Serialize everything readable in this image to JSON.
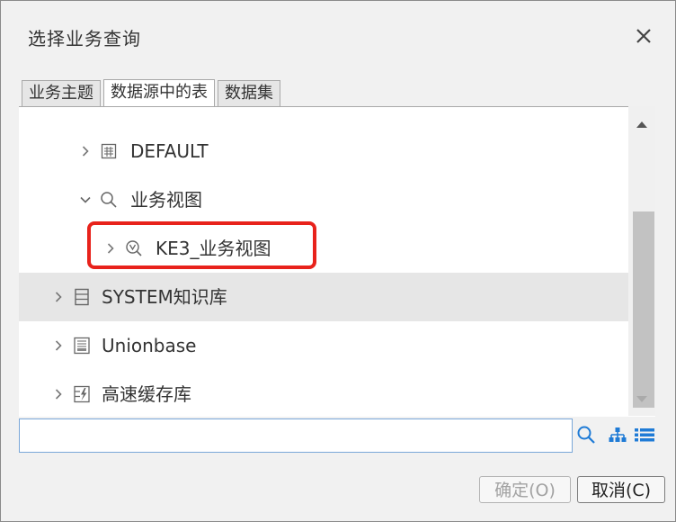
{
  "dialog": {
    "title": "选择业务查询",
    "close_label": "×"
  },
  "tabs": [
    {
      "label": "业务主题",
      "active": false
    },
    {
      "label": "数据源中的表",
      "active": true
    },
    {
      "label": "数据集",
      "active": false
    }
  ],
  "tree": {
    "items": [
      {
        "label": "DEFAULT",
        "icon": "schema-icon",
        "expanded": false,
        "selected": false
      },
      {
        "label": "业务视图",
        "icon": "search-view-icon",
        "expanded": true,
        "selected": false
      },
      {
        "label": "KE3_业务视图",
        "icon": "business-view-icon",
        "expanded": false,
        "selected": false,
        "highlighted": true
      },
      {
        "label": "SYSTEM知识库",
        "icon": "database-icon",
        "expanded": false,
        "selected": true
      },
      {
        "label": "Unionbase",
        "icon": "database-server-icon",
        "expanded": false,
        "selected": false
      },
      {
        "label": "高速缓存库",
        "icon": "cache-db-icon",
        "expanded": false,
        "selected": false
      }
    ]
  },
  "search": {
    "value": "",
    "placeholder": ""
  },
  "toolbar": {
    "search_icon": "search-icon",
    "tree_view_icon": "tree-view-icon",
    "list_view_icon": "list-view-icon"
  },
  "buttons": {
    "ok_label": "确定(O)",
    "cancel_label": "取消(C)"
  },
  "colors": {
    "highlight": "#e8221b",
    "accent": "#1f7bd6",
    "selected_row": "#e6e6e6"
  }
}
